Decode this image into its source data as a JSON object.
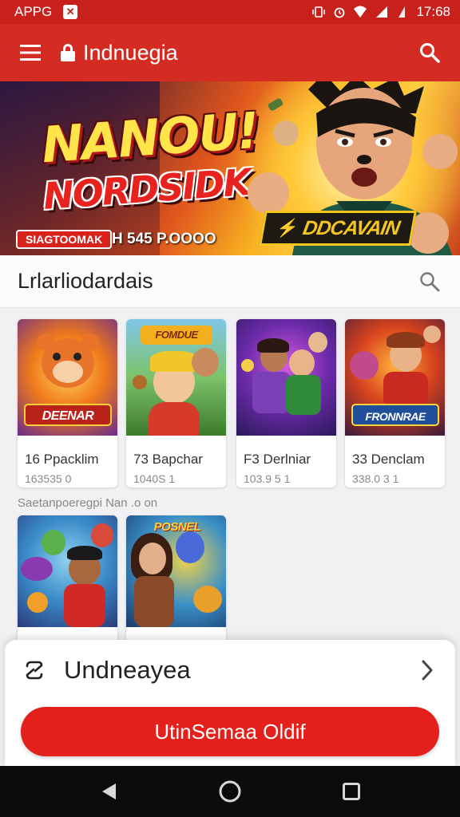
{
  "status_bar": {
    "app_label": "APPG",
    "time": "17:68",
    "icons": [
      "close-box-icon",
      "vibrate-icon",
      "alarm-icon",
      "wifi-icon",
      "signal-icon",
      "battery-icon"
    ]
  },
  "app_bar": {
    "title": "Indnuegia",
    "icons": [
      "menu-icon",
      "lock-icon",
      "search-icon"
    ]
  },
  "banner": {
    "title": "NANOU!",
    "subtitle": "NORDSIDK",
    "tag": "SIAGTOOMAK",
    "prize": "H  545 P.OOOO",
    "badge": "DDCAVAIN"
  },
  "search": {
    "text": "Lrlarliodardais"
  },
  "games": [
    {
      "name": "16 Ppacklim",
      "meta": "163535 0",
      "logo": "DEENAR",
      "theme": "fox"
    },
    {
      "name": "73 Bapchar",
      "meta": "1040S 1",
      "logo": "FOMDUE",
      "theme": "kids"
    },
    {
      "name": "F3 Derlniar",
      "meta": "103.9 5 1",
      "logo": "",
      "theme": "purple"
    },
    {
      "name": "33 Denclam",
      "meta": "338.0 3 1",
      "logo": "FRONNRAE",
      "theme": "red"
    }
  ],
  "section_label": "Saetanpoeregpi Nan .o on",
  "games_row2": [
    {
      "logo": "",
      "theme": "heroes"
    },
    {
      "logo": "POSNEL",
      "theme": "girl"
    }
  ],
  "bottom_sheet": {
    "title": "Undneayea",
    "cta_label": "UtinSemaa Oldif"
  },
  "colors": {
    "primary": "#d42c22",
    "status": "#c8201b",
    "cta": "#e3201b"
  }
}
